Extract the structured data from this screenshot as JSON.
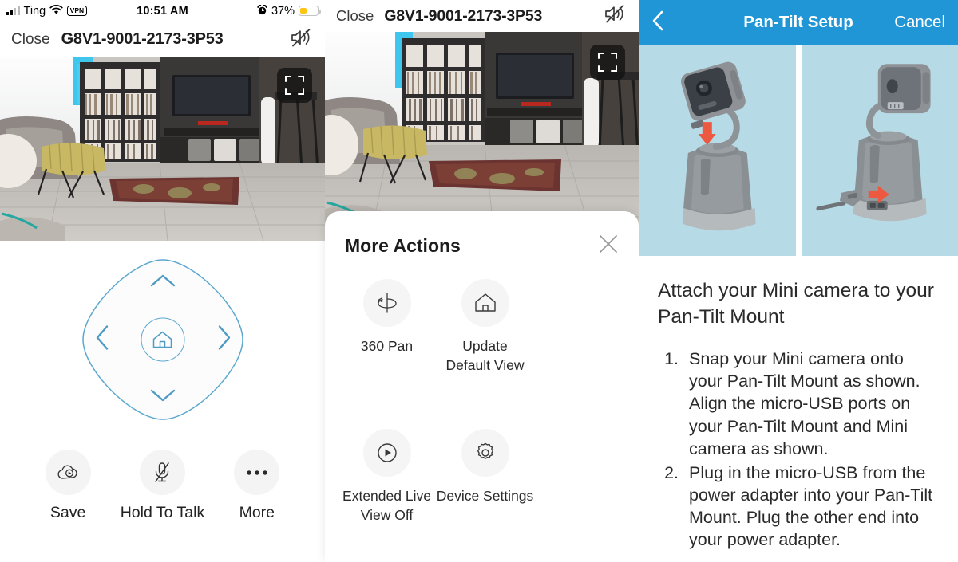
{
  "panel_live": {
    "status_bar": {
      "signal_icon": "signal-bars-icon",
      "carrier": "Ting",
      "wifi_icon": "wifi-icon",
      "vpn_badge": "VPN",
      "time": "10:51 AM",
      "alarm_icon": "alarm-clock-icon",
      "battery_percent": "37%",
      "battery_icon": "battery-icon"
    },
    "nav": {
      "close_label": "Close",
      "device_id": "G8V1-9001-2173-3P53",
      "mute_icon": "speaker-muted-icon"
    },
    "video": {
      "fullscreen_icon": "fullscreen-icon"
    },
    "dpad": {
      "up_icon": "chevron-up-icon",
      "down_icon": "chevron-down-icon",
      "left_icon": "chevron-left-icon",
      "right_icon": "chevron-right-icon",
      "home_icon": "home-icon",
      "accent_color": "#5ba8cf"
    },
    "actions": [
      {
        "icon": "cloud-record-icon",
        "label": "Save"
      },
      {
        "icon": "microphone-muted-icon",
        "label": "Hold To Talk"
      },
      {
        "icon": "ellipsis-icon",
        "label": "More"
      }
    ]
  },
  "panel_more_actions": {
    "nav": {
      "close_label": "Close",
      "device_id": "G8V1-9001-2173-3P53",
      "mute_icon": "speaker-muted-icon"
    },
    "video": {
      "fullscreen_icon": "fullscreen-icon"
    },
    "sheet": {
      "title": "More Actions",
      "close_icon": "close-x-icon",
      "items": [
        {
          "icon": "pan-360-icon",
          "label": "360 Pan"
        },
        {
          "icon": "home-icon",
          "label": "Update\nDefault View"
        },
        {
          "icon": "play-circle-icon",
          "label": "Extended Live\nView Off"
        },
        {
          "icon": "gear-icon",
          "label": "Device Settings"
        }
      ]
    }
  },
  "panel_setup": {
    "nav": {
      "back_icon": "chevron-left-icon",
      "title": "Pan-Tilt Setup",
      "cancel_label": "Cancel",
      "bar_color": "#2196d6"
    },
    "illustration": {
      "background_color": "#b7dbe6",
      "left_image": "mini-camera-snapping-onto-pan-tilt-mount-illustration",
      "right_image": "micro-usb-cable-plugging-into-pan-tilt-mount-illustration"
    },
    "heading": "Attach your Mini camera to your Pan-Tilt Mount",
    "steps": [
      "Snap your Mini camera onto your Pan-Tilt Mount as shown. Align the micro-USB ports on your Pan-Tilt Mount and Mini camera as shown.",
      "Plug in the micro-USB from the power adapter into your Pan-Tilt Mount. Plug the other end into your power adapter."
    ]
  }
}
